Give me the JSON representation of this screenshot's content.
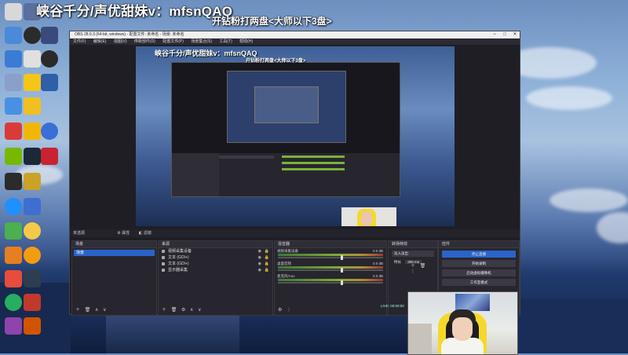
{
  "overlay": {
    "title": "峡谷千分/声优甜妹v：mfsnQAQ",
    "subtitle": "开钻粉打两盘<大师以下3盘>"
  },
  "obs": {
    "window_title": "OBS 28.0.3 (64-bit, windows) - 配置文件: 未命名 - 场景: 未命名",
    "menu": [
      "文件(F)",
      "编辑(E)",
      "视图(V)",
      "停靠部件(D)",
      "配置文件(P)",
      "场景集合(S)",
      "工具(T)",
      "帮助(H)"
    ],
    "toolstrip": {
      "source_label": "未选源",
      "properties_label": "属性",
      "filters_label": "滤镜"
    },
    "scenes": {
      "header": "场景",
      "items": [
        "场景"
      ]
    },
    "sources": {
      "header": "来源",
      "items": [
        "视频采集设备",
        "文本 (GDI+)",
        "文本 (GDI+)",
        "显示器采集"
      ]
    },
    "mixer": {
      "header": "混音器",
      "channels": [
        {
          "name": "视频采集设备",
          "db": "0.0 dB"
        },
        {
          "name": "桌面音频",
          "db": "0.0 dB"
        },
        {
          "name": "麦克风/Aux",
          "db": "0.0 dB"
        }
      ]
    },
    "transitions": {
      "header": "转场特效",
      "type": "淡入淡出",
      "duration_label": "时长",
      "duration_value": "300 ms"
    },
    "controls": {
      "header": "控件",
      "buttons": [
        "停止直播",
        "开始录制",
        "启动虚拟摄像机",
        "工作室模式"
      ]
    },
    "status": "LIVE: 00:00:00"
  },
  "desktop": {
    "icons": [
      "回收站",
      "此电脑",
      "网络",
      "控制面板",
      "Steam",
      "Edge",
      "腾讯QQ",
      "微信",
      "OBS Studio",
      "NVIDIA",
      "WeGame",
      "英雄联盟",
      "网易云音乐",
      "Chrome",
      "王者荣耀"
    ]
  }
}
